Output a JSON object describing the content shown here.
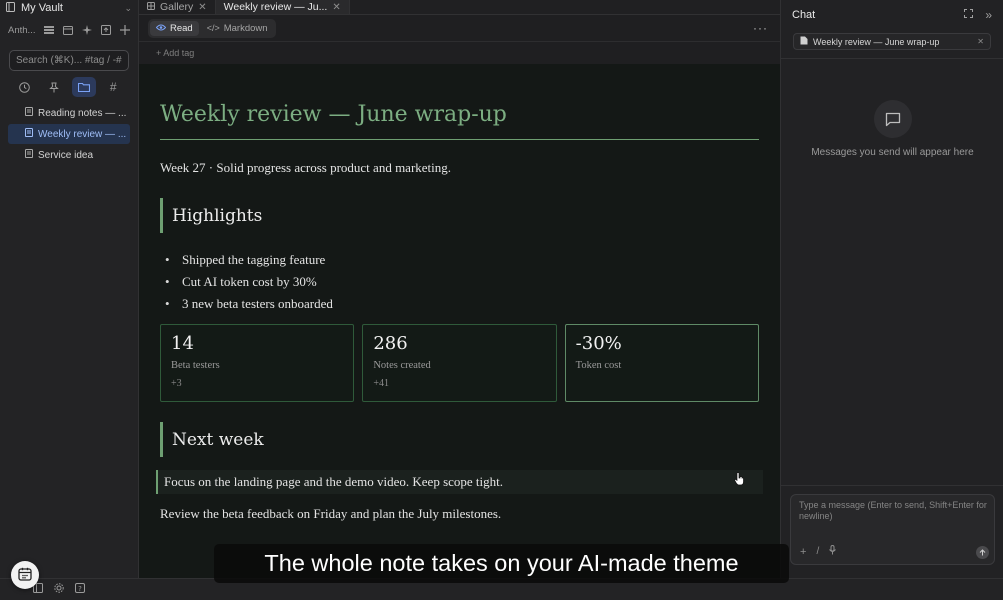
{
  "sidebar": {
    "vault_name": "My Vault",
    "toolbar_label": "Anth...",
    "search": {
      "placeholder": "Search (⌘K)... #tag / -#exclude",
      "value": ""
    },
    "files": [
      {
        "title": "Reading notes — ...",
        "selected": false
      },
      {
        "title": "Weekly review — ...",
        "selected": true
      },
      {
        "title": "Service idea",
        "selected": false
      }
    ]
  },
  "tabs": [
    {
      "label": "Gallery",
      "active": false
    },
    {
      "label": "Weekly review — Ju...",
      "active": true
    }
  ],
  "view_modes": {
    "read": "Read",
    "markdown": "Markdown",
    "active": "read"
  },
  "add_tag_label": "+ Add tag",
  "note": {
    "title": "Weekly review — June wrap-up",
    "intro": "Week 27 · Solid progress across product and marketing.",
    "highlights_heading": "Highlights",
    "highlights": [
      "Shipped the tagging feature",
      "Cut AI token cost by 30%",
      "3 new beta testers onboarded"
    ],
    "stats": [
      {
        "value": "14",
        "label": "Beta testers",
        "delta": "+3"
      },
      {
        "value": "286",
        "label": "Notes created",
        "delta": "+41"
      },
      {
        "value": "-30%",
        "label": "Token cost",
        "delta": ""
      }
    ],
    "next_week_heading": "Next week",
    "callout": "Focus on the landing page and the demo video. Keep scope tight.",
    "paragraph": "Review the beta feedback on Friday and plan the July milestones."
  },
  "chat": {
    "title": "Chat",
    "context_chip": "Weekly review — June wrap-up",
    "empty_state": "Messages you send will appear here",
    "composer_placeholder": "Type a message (Enter to send, Shift+Enter for newline)"
  },
  "caption": "The whole note takes on your AI-made theme",
  "theme": {
    "accent": "#7cae82",
    "note_background": "#141816",
    "selection": "#25344f",
    "link_blue": "#7aa2f7"
  }
}
